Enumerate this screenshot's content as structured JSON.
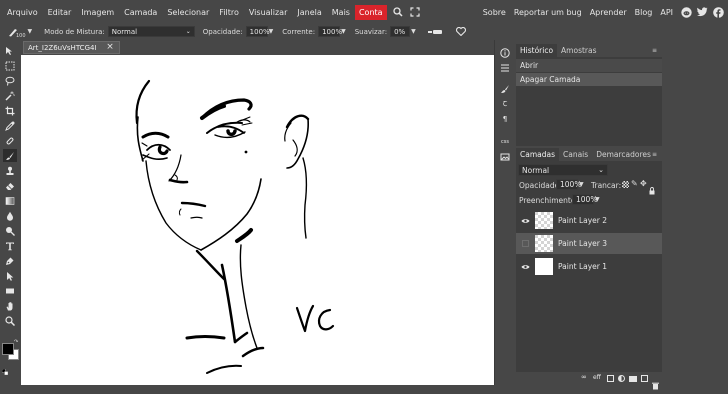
{
  "menu": {
    "items": [
      "Arquivo",
      "Editar",
      "Imagem",
      "Camada",
      "Selecionar",
      "Filtro",
      "Visualizar",
      "Janela",
      "Mais"
    ],
    "highlight": "Conta",
    "right_items": [
      "Sobre",
      "Reportar um bug",
      "Aprender",
      "Blog",
      "API"
    ]
  },
  "options": {
    "size_value": "100",
    "blend_label": "Modo de Mistura:",
    "blend_value": "Normal",
    "opacity_label": "Opacidade:",
    "opacity_value": "100%",
    "flow_label": "Corrente:",
    "flow_value": "100%",
    "smooth_label": "Suavizar:",
    "smooth_value": "0%"
  },
  "document": {
    "tab_title": "Art_I2Z6uVsHTCG4I",
    "close_glyph": "×"
  },
  "history": {
    "tabs": [
      "Histórico",
      "Amostras"
    ],
    "entries": [
      "Abrir",
      "Apagar Camada"
    ]
  },
  "layers": {
    "tabs": [
      "Camadas",
      "Canais",
      "Demarcadores"
    ],
    "blend_value": "Normal",
    "opacity_label": "Opacidade:",
    "opacity_value": "100%",
    "lock_label": "Trancar:",
    "fill_label": "Preenchimento:",
    "fill_value": "100%",
    "items": [
      {
        "name": "Paint Layer 2",
        "visible": true,
        "selected": false
      },
      {
        "name": "Paint Layer 3",
        "visible": false,
        "selected": true
      },
      {
        "name": "Paint Layer 1",
        "visible": true,
        "selected": false
      }
    ]
  },
  "icons": {
    "side_panel_text_1": "Ꞇ",
    "side_panel_text_2": "¶",
    "css_label": "css"
  },
  "colors": {
    "accent": "#d9242b",
    "foreground": "#000000",
    "background": "#ffffff"
  }
}
